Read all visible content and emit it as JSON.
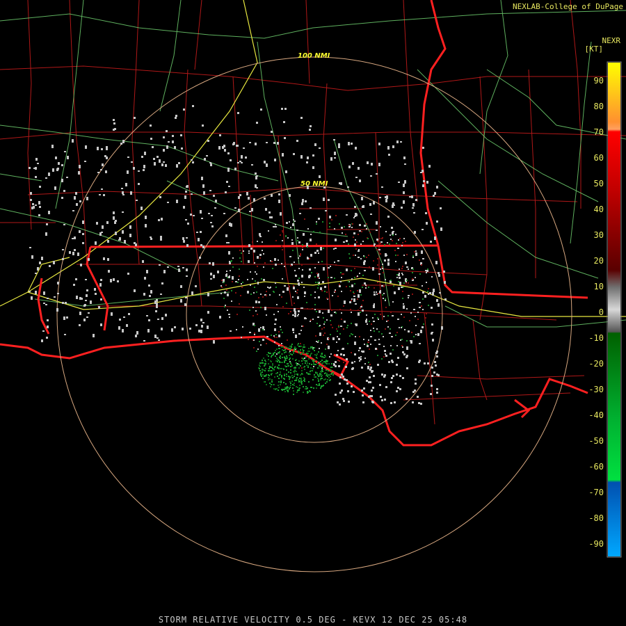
{
  "header": {
    "credit": "NEXLAB-College of DuPage",
    "product_code": "NEXR",
    "unit": "[KT]"
  },
  "footer": {
    "caption": "STORM RELATIVE VELOCITY 0.5 DEG - KEVX 12 DEC 25 05:48"
  },
  "range_rings": [
    {
      "label": "50 NMI"
    },
    {
      "label": "100 NMI"
    }
  ],
  "legend": {
    "ticks": [
      "90",
      "80",
      "70",
      "60",
      "50",
      "40",
      "30",
      "20",
      "10",
      "0",
      "-10",
      "-20",
      "-30",
      "-40",
      "-50",
      "-60",
      "-70",
      "-80",
      "-90"
    ],
    "colors": {
      "high_positive": "#ffff00",
      "positive_orange": "#ffa060",
      "positive_red": "#ff0000",
      "positive_darkred": "#6a0000",
      "near_zero": "#c0c0c0",
      "negative_darkgreen": "#006000",
      "negative_green": "#00e040",
      "negative_blue": "#0060c0",
      "negative_cyan": "#00a0ff"
    }
  },
  "map_colors": {
    "coast_state": "#ff2020",
    "county": "#b01818",
    "interstate": "#e8e840",
    "highway": "#70d070",
    "ring": "#d8a880",
    "echo_gray": "#c8c8c8"
  }
}
